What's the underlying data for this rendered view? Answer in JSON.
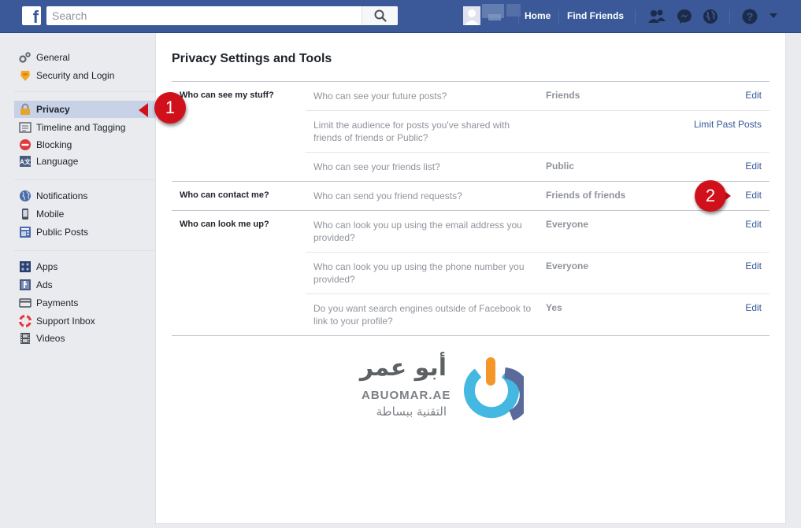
{
  "header": {
    "logo_letter": "f",
    "search_placeholder": "Search",
    "nav": [
      "Home",
      "Find Friends"
    ],
    "brand_color": "#3b5998",
    "icons": [
      "friend-requests-icon",
      "messenger-icon",
      "notifications-globe-icon",
      "help-icon",
      "account-menu-caret-icon"
    ]
  },
  "sidebar": {
    "groups": [
      [
        {
          "label": "General",
          "icon": "gear-icon"
        },
        {
          "label": "Security and Login",
          "icon": "badge-icon"
        }
      ],
      [
        {
          "label": "Privacy",
          "icon": "lock-icon",
          "active": true
        },
        {
          "label": "Timeline and Tagging",
          "icon": "timeline-icon"
        },
        {
          "label": "Blocking",
          "icon": "block-icon"
        },
        {
          "label": "Language",
          "icon": "language-icon"
        }
      ],
      [
        {
          "label": "Notifications",
          "icon": "globe-icon"
        },
        {
          "label": "Mobile",
          "icon": "mobile-icon"
        },
        {
          "label": "Public Posts",
          "icon": "rss-icon"
        }
      ],
      [
        {
          "label": "Apps",
          "icon": "apps-icon"
        },
        {
          "label": "Ads",
          "icon": "ads-icon"
        },
        {
          "label": "Payments",
          "icon": "card-icon"
        },
        {
          "label": "Support Inbox",
          "icon": "lifebuoy-icon"
        },
        {
          "label": "Videos",
          "icon": "film-icon"
        }
      ]
    ]
  },
  "main": {
    "title": "Privacy Settings and Tools",
    "sections": [
      {
        "title": "Who can see my stuff?",
        "rows": [
          {
            "question": "Who can see your future posts?",
            "value": "Friends",
            "action": "Edit"
          },
          {
            "question": "Limit the audience for posts you've shared with friends of friends or Public?",
            "value": "",
            "action": "Limit Past Posts"
          },
          {
            "question": "Who can see your friends list?",
            "value": "Public",
            "action": "Edit"
          }
        ]
      },
      {
        "title": "Who can contact me?",
        "rows": [
          {
            "question": "Who can send you friend requests?",
            "value": "Friends of friends",
            "action": "Edit"
          }
        ]
      },
      {
        "title": "Who can look me up?",
        "rows": [
          {
            "question": "Who can look you up using the email address you provided?",
            "value": "Everyone",
            "action": "Edit"
          },
          {
            "question": "Who can look you up using the phone number you provided?",
            "value": "Everyone",
            "action": "Edit"
          },
          {
            "question": "Do you want search engines outside of Facebook to link to your profile?",
            "value": "Yes",
            "action": "Edit"
          }
        ]
      }
    ]
  },
  "callouts": [
    "1",
    "2"
  ],
  "watermark": {
    "arabic_name": "أبو عمر",
    "latin": "ABUOMAR.AE",
    "tagline": "التقنية ببساطة"
  }
}
